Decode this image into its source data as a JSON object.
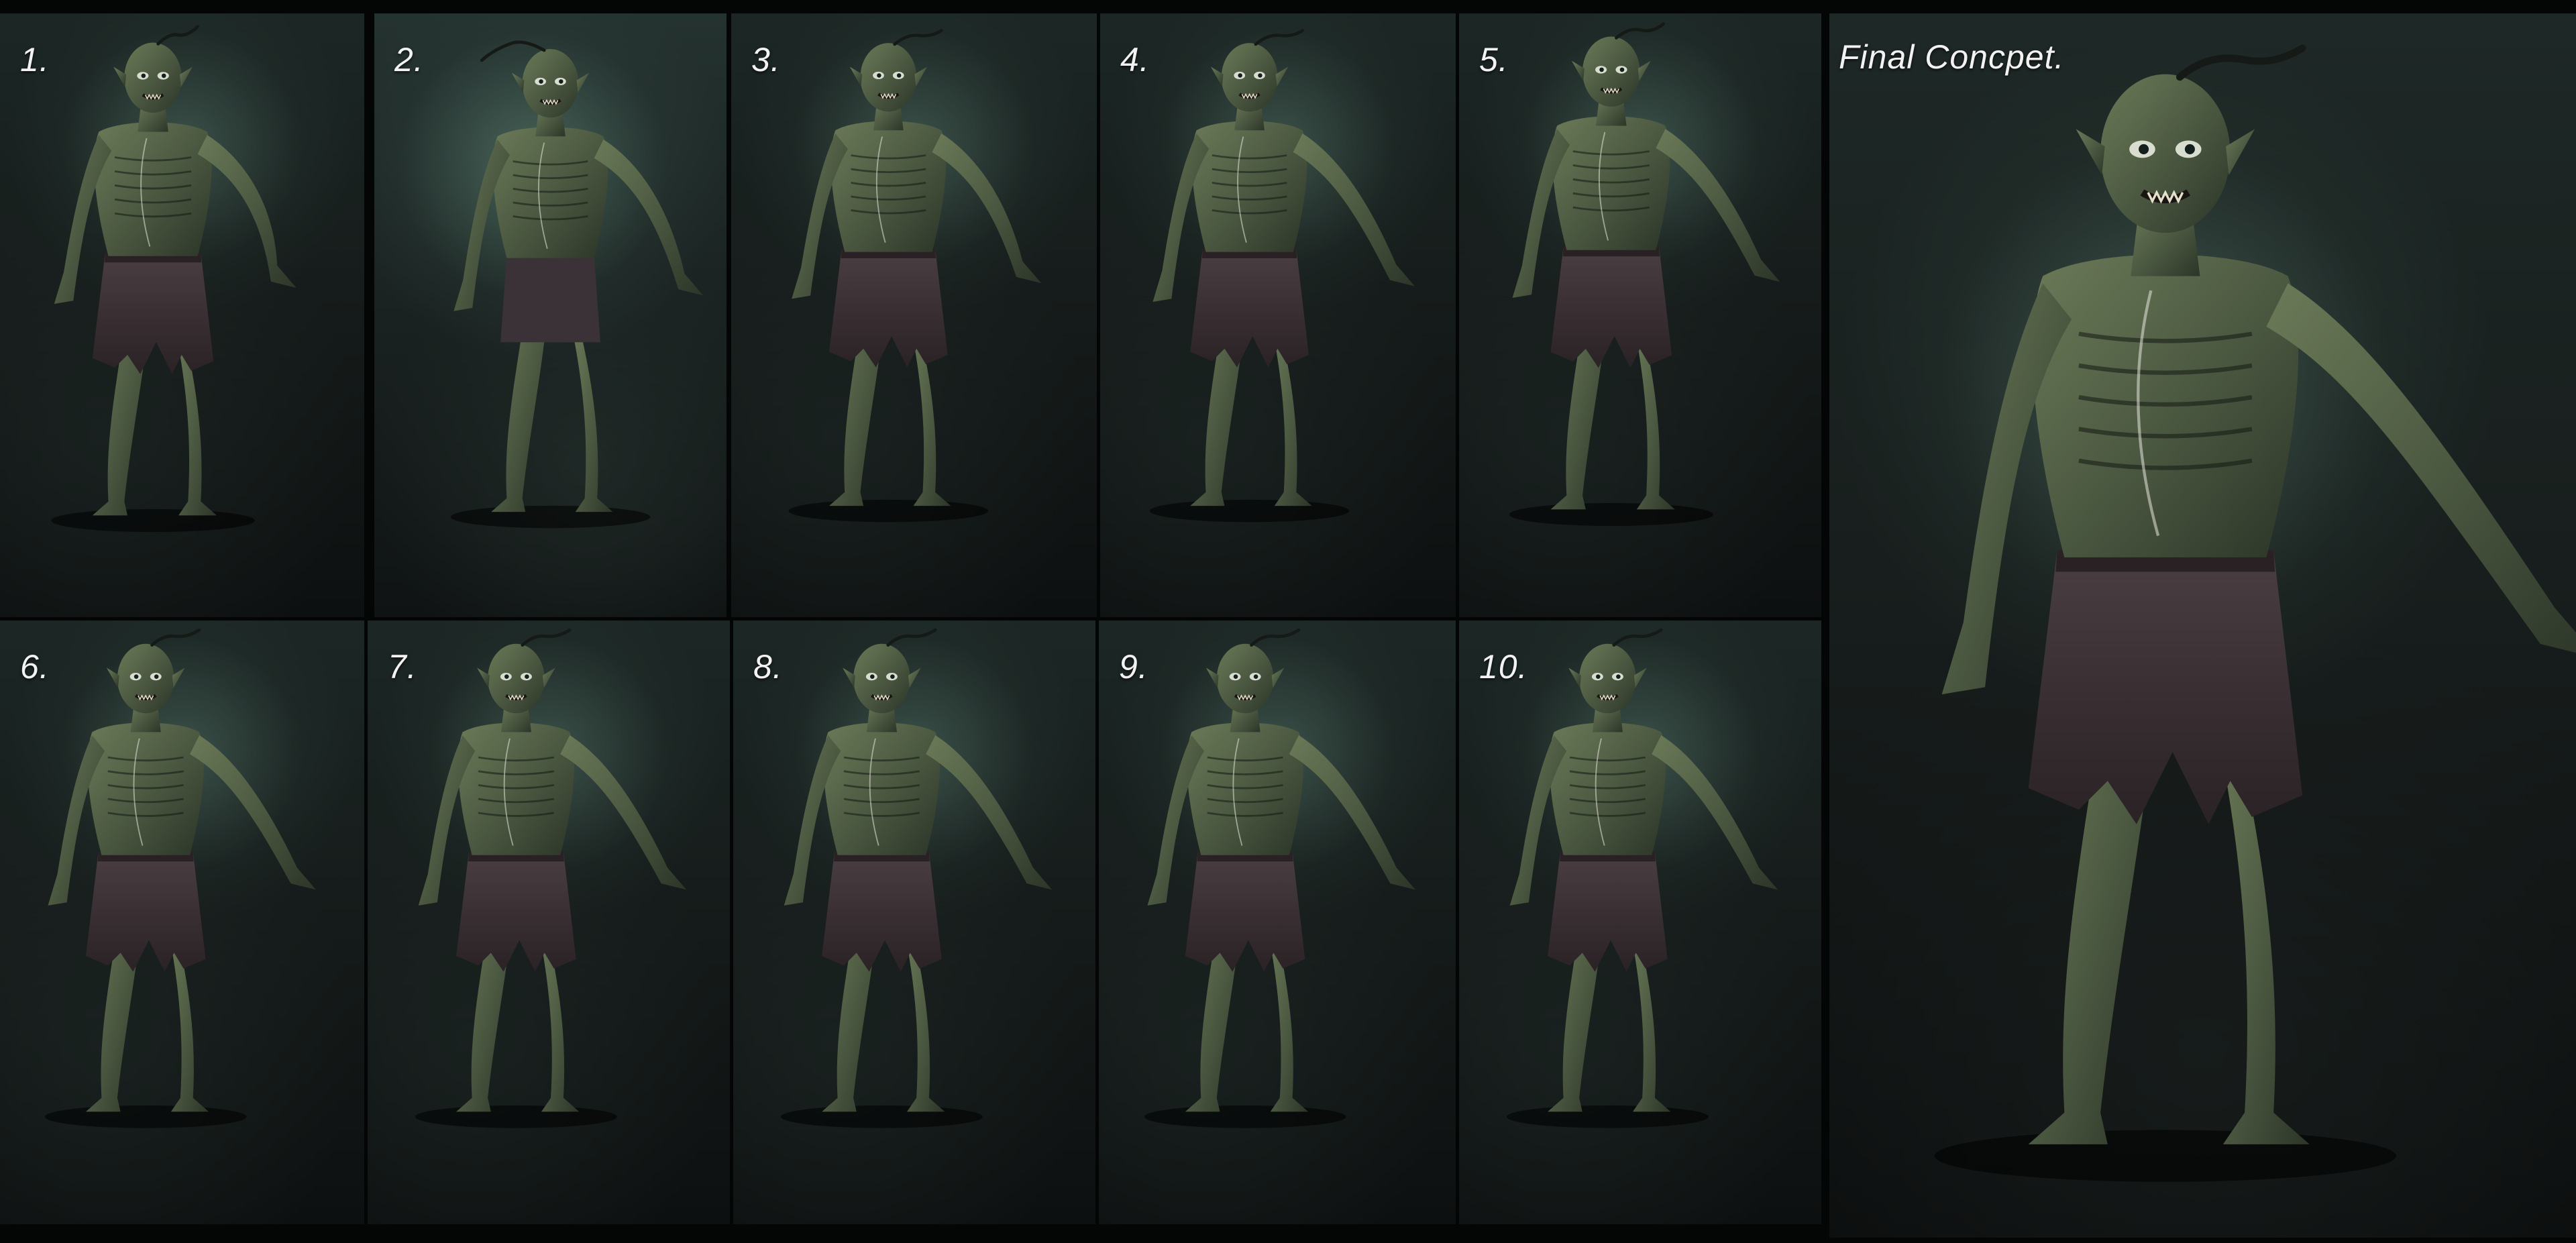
{
  "sheet": {
    "panels": [
      {
        "label": "1."
      },
      {
        "label": "2."
      },
      {
        "label": "3."
      },
      {
        "label": "4."
      },
      {
        "label": "5."
      },
      {
        "label": "6."
      },
      {
        "label": "7."
      },
      {
        "label": "8."
      },
      {
        "label": "9."
      },
      {
        "label": "10."
      }
    ],
    "final_label": "Final Concpet."
  },
  "colors": {
    "background": "#040505",
    "label_text": "#f2f2f2",
    "skin": "#4d5a42",
    "skin_dark": "#2c3528",
    "shorts": "#3b3134",
    "shorts_dark": "#2a2225",
    "backdrop_glow": "#5d7e72"
  }
}
